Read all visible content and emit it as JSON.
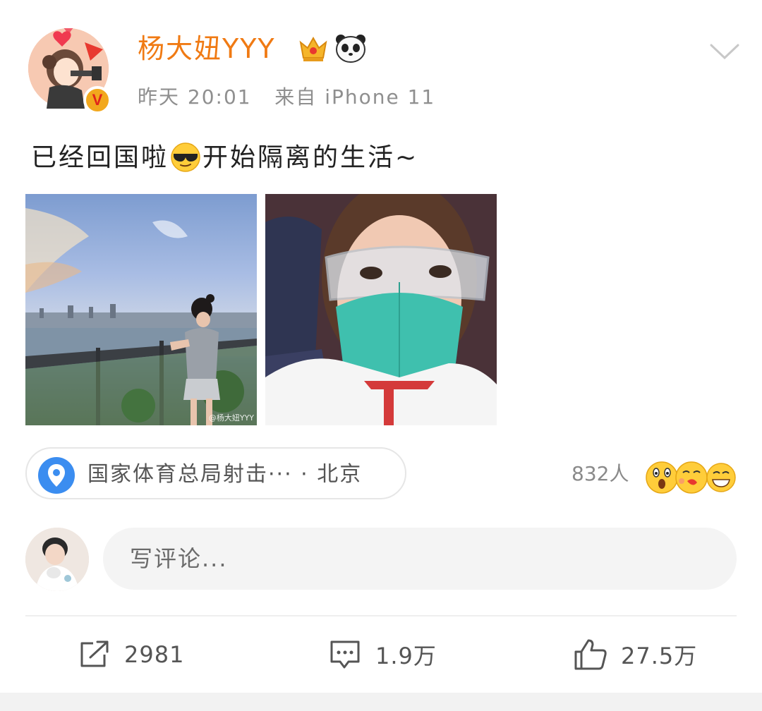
{
  "user": {
    "name": "杨大妞YYY",
    "time": "昨天 20:01",
    "source": "来自 iPhone 11",
    "verified_badge": "V"
  },
  "post": {
    "text_before": "已经回国啦",
    "text_after": "开始隔离的生活~",
    "photo_watermark": "@杨大妞YYY"
  },
  "location": {
    "text": "国家体育总局射击··· · 北京"
  },
  "reactions": {
    "count": "832人"
  },
  "comment": {
    "placeholder": "写评论..."
  },
  "actions": {
    "repost": "2981",
    "comment": "1.9万",
    "like": "27.5万"
  },
  "colors": {
    "username": "#f07a13",
    "meta": "#8f8f8f",
    "location_pin": "#3b8df0",
    "verified": "#f2a81d"
  },
  "icons": {
    "crown": "crown-icon",
    "panda": "panda-icon",
    "more": "chevron-down-icon",
    "location": "location-pin-icon",
    "repost": "share-icon",
    "comment": "comment-icon",
    "like": "thumbs-up-icon"
  }
}
